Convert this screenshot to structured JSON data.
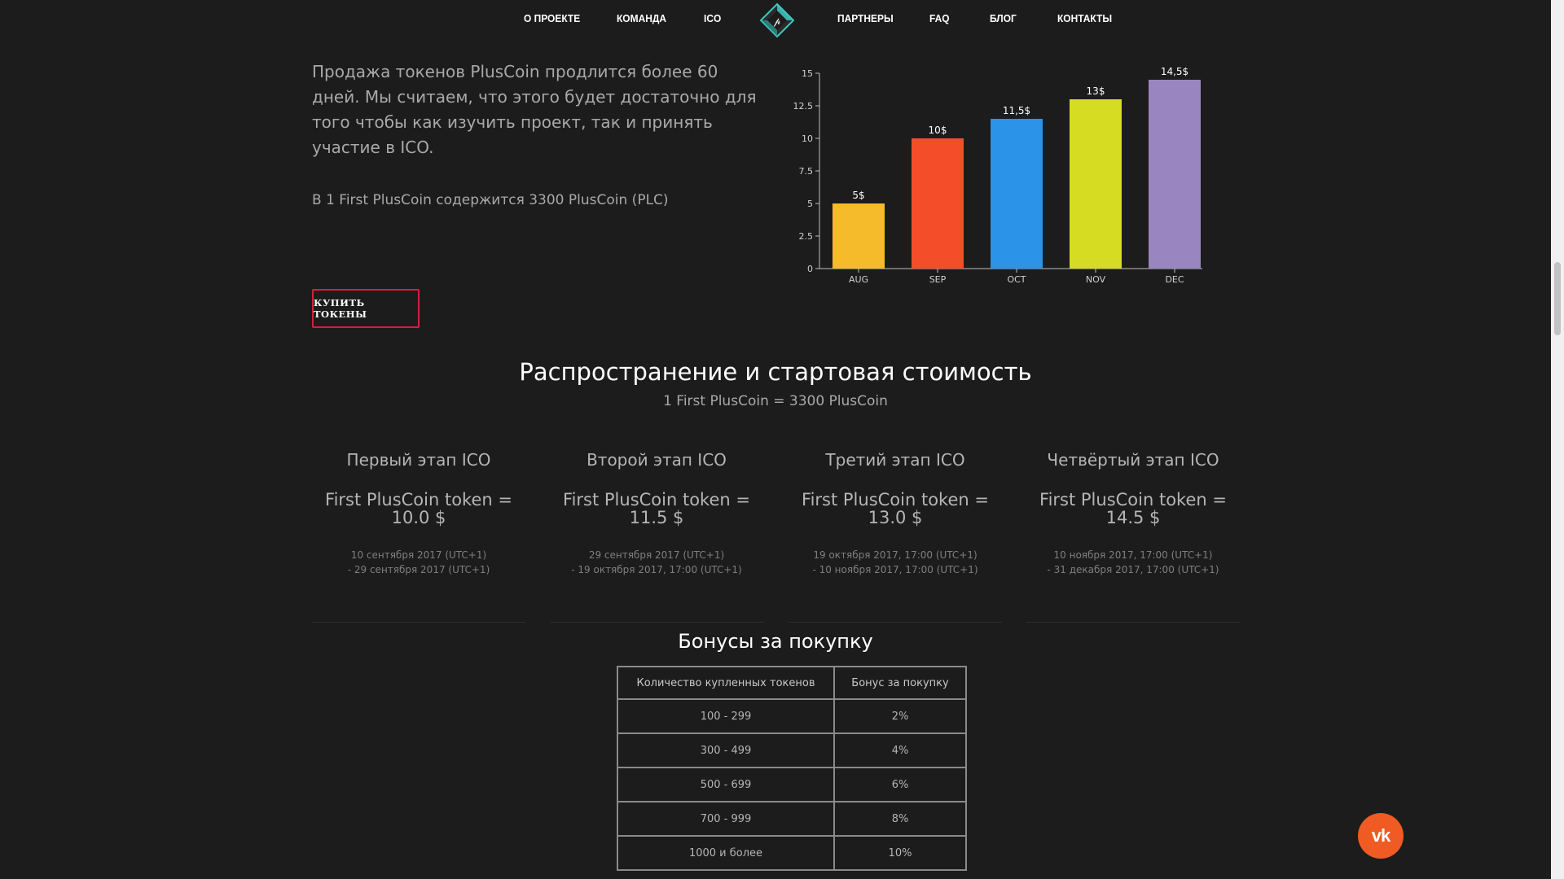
{
  "nav": {
    "items_left": [
      "О ПРОЕКТЕ",
      "КОМАНДА",
      "ICO"
    ],
    "items_right": [
      "ПАРТНЕРЫ",
      "FAQ",
      "БЛОГ",
      "КОНТАКТЫ"
    ],
    "logo_icon": "pluscoin-diamond-logo-icon"
  },
  "intro": {
    "text": "Продажа токенов PlusCoin продлится более 60 дней. Мы считаем, что этого будет достаточно для того чтобы как изучить проект, так и принять участие в ICO.",
    "contains": "В 1 First PlusCoin содержится 3300 PlusCoin (PLC)",
    "buy_button": "КУПИТЬ ТОКЕНЫ"
  },
  "chart_data": {
    "type": "bar",
    "categories": [
      "AUG",
      "SEP",
      "OCT",
      "NOV",
      "DEC"
    ],
    "values": [
      5,
      10,
      11.5,
      13,
      14.5
    ],
    "data_labels": [
      "5$",
      "10$",
      "11,5$",
      "13$",
      "14,5$"
    ],
    "colors": [
      "#f6bb2a",
      "#f44d2a",
      "#2b93e8",
      "#d5dc22",
      "#9985bf"
    ],
    "ylim": [
      0,
      15
    ],
    "yticks": [
      "0",
      "2.5",
      "5",
      "7.5",
      "10",
      "12.5",
      "15"
    ],
    "title": "",
    "xlabel": "",
    "ylabel": "",
    "grid": false
  },
  "distribution": {
    "title": "Распространение и стартовая стоимость",
    "subtitle": "1 First PlusCoin = 3300 PlusCoin",
    "stages": [
      {
        "title": "Первый этап ICO",
        "price_line1": "First PlusCoin token =",
        "price_line2": "10.0 $",
        "date_line1": "10 сентября 2017 (UTC+1)",
        "date_line2": "- 29 сентября 2017 (UTC+1)"
      },
      {
        "title": "Второй этап ICO",
        "price_line1": "First PlusCoin token =",
        "price_line2": "11.5 $",
        "date_line1": "29 сентября 2017 (UTC+1)",
        "date_line2": "- 19 октября 2017, 17:00 (UTC+1)"
      },
      {
        "title": "Третий этап ICO",
        "price_line1": "First PlusCoin token =",
        "price_line2": "13.0 $",
        "date_line1": "19 октября 2017, 17:00 (UTC+1)",
        "date_line2": "- 10 ноября 2017, 17:00 (UTC+1)"
      },
      {
        "title": "Четвёртый этап ICO",
        "price_line1": "First PlusCoin token =",
        "price_line2": "14.5 $",
        "date_line1": "10 ноября 2017, 17:00 (UTC+1)",
        "date_line2": "- 31 декабря 2017, 17:00 (UTC+1)"
      }
    ]
  },
  "bonus": {
    "title": "Бонусы за покупку",
    "headers": [
      "Количество купленных токенов",
      "Бонус за покупку"
    ],
    "rows": [
      [
        "100 - 299",
        "2%"
      ],
      [
        "300 - 499",
        "4%"
      ],
      [
        "500 - 699",
        "6%"
      ],
      [
        "700 - 999",
        "8%"
      ],
      [
        "1000 и более",
        "10%"
      ]
    ]
  },
  "social": {
    "vk_label": "vk",
    "vk_icon": "vk-icon",
    "vk_color": "#f05a23"
  },
  "colors": {
    "background": "#1c1c1c",
    "accent_button_border": "#d1213d",
    "logo_teal": "#3fc8c0"
  }
}
